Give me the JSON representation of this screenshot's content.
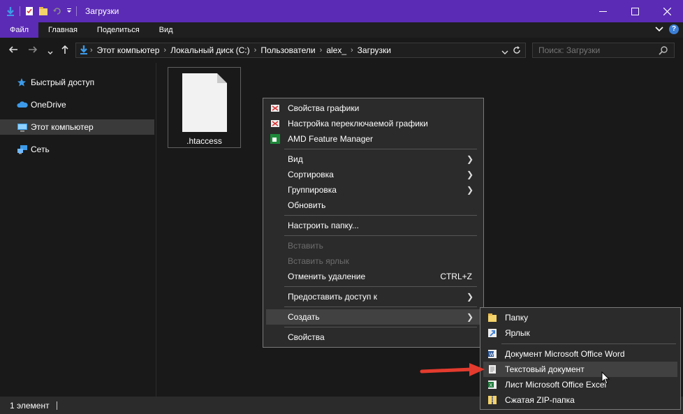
{
  "window": {
    "title": "Загрузки",
    "accent": "#5b2bb5"
  },
  "ribbon": {
    "tabs": [
      "Файл",
      "Главная",
      "Поделиться",
      "Вид"
    ],
    "help": "?"
  },
  "address": {
    "crumbs": [
      "Этот компьютер",
      "Локальный диск (C:)",
      "Пользователи",
      "alex_",
      "Загрузки"
    ]
  },
  "search": {
    "placeholder": "Поиск: Загрузки"
  },
  "nav": {
    "items": [
      "Быстрый доступ",
      "OneDrive",
      "Этот компьютер",
      "Сеть"
    ]
  },
  "content": {
    "file_name": ".htaccess"
  },
  "status": {
    "count": "1 элемент"
  },
  "context_menu": {
    "graphics_props": "Свойства графики",
    "switch_graphics": "Настройка переключаемой графики",
    "amd": "AMD Feature Manager",
    "view": "Вид",
    "sort": "Сортировка",
    "group": "Группировка",
    "refresh": "Обновить",
    "customize": "Настроить папку...",
    "paste": "Вставить",
    "paste_link": "Вставить ярлык",
    "undo_delete": "Отменить удаление",
    "undo_shortcut": "CTRL+Z",
    "share": "Предоставить доступ к",
    "create": "Создать",
    "properties": "Свойства"
  },
  "submenu": {
    "folder": "Папку",
    "shortcut": "Ярлык",
    "word": "Документ Microsoft Office Word",
    "text": "Текстовый документ",
    "excel": "Лист Microsoft Office Excel",
    "zip": "Сжатая ZIP-папка"
  },
  "icons": {
    "quick_access": "star-icon",
    "onedrive": "cloud-icon",
    "this_pc": "computer-icon",
    "network": "network-icon"
  }
}
